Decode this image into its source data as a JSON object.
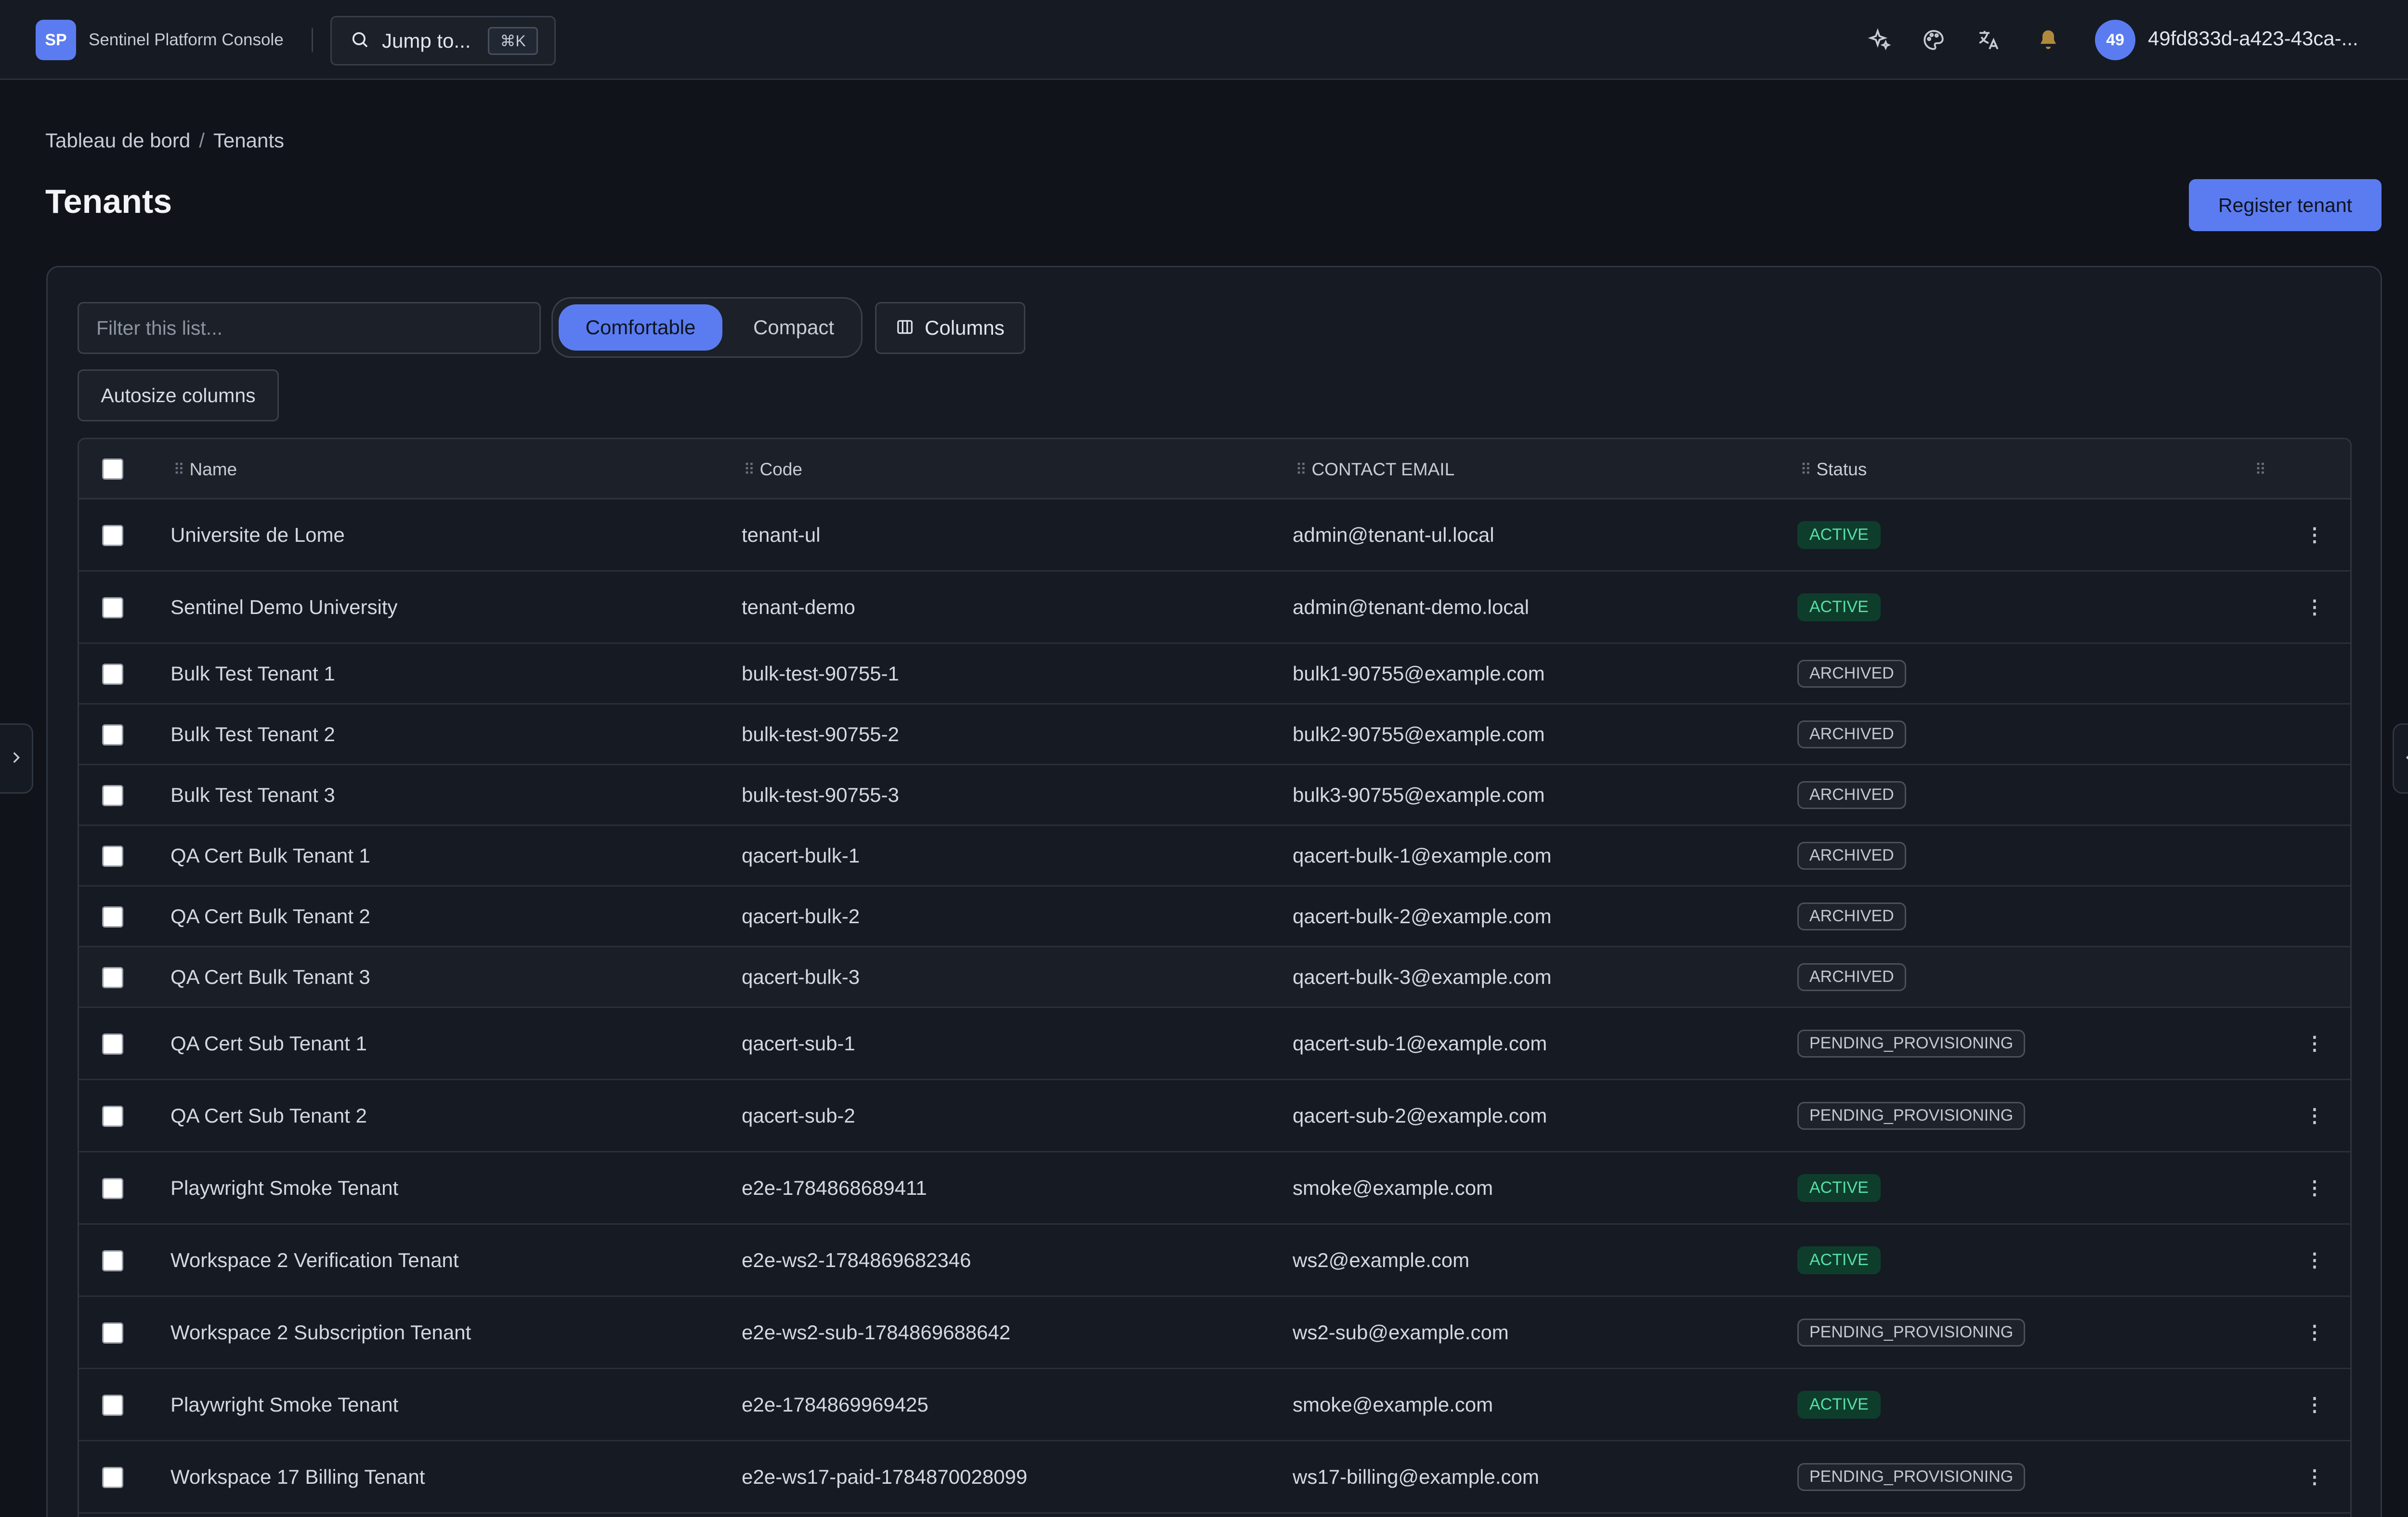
{
  "app": {
    "brand_initials": "SP",
    "brand_name": "Sentinel Platform Console",
    "jump_label": "Jump to...",
    "jump_shortcut": "⌘K",
    "user_initials": "49",
    "user_id": "49fd833d-a423-43ca-..."
  },
  "breadcrumb": {
    "home": "Tableau de bord",
    "separator": "/",
    "current": "Tenants"
  },
  "page": {
    "title": "Tenants",
    "register_label": "Register tenant"
  },
  "toolbar": {
    "filter_placeholder": "Filter this list...",
    "density_comfortable": "Comfortable",
    "density_compact": "Compact",
    "columns_label": "Columns",
    "autosize_label": "Autosize columns"
  },
  "table": {
    "headers": {
      "name": "Name",
      "code": "Code",
      "email": "CONTACT EMAIL",
      "status": "Status"
    },
    "rows": [
      {
        "name": "Universite de Lome",
        "code": "tenant-ul",
        "email": "admin@tenant-ul.local",
        "status": "ACTIVE"
      },
      {
        "name": "Sentinel Demo University",
        "code": "tenant-demo",
        "email": "admin@tenant-demo.local",
        "status": "ACTIVE"
      },
      {
        "name": "Bulk Test Tenant 1",
        "code": "bulk-test-90755-1",
        "email": "bulk1-90755@example.com",
        "status": "ARCHIVED"
      },
      {
        "name": "Bulk Test Tenant 2",
        "code": "bulk-test-90755-2",
        "email": "bulk2-90755@example.com",
        "status": "ARCHIVED"
      },
      {
        "name": "Bulk Test Tenant 3",
        "code": "bulk-test-90755-3",
        "email": "bulk3-90755@example.com",
        "status": "ARCHIVED"
      },
      {
        "name": "QA Cert Bulk Tenant 1",
        "code": "qacert-bulk-1",
        "email": "qacert-bulk-1@example.com",
        "status": "ARCHIVED"
      },
      {
        "name": "QA Cert Bulk Tenant 2",
        "code": "qacert-bulk-2",
        "email": "qacert-bulk-2@example.com",
        "status": "ARCHIVED"
      },
      {
        "name": "QA Cert Bulk Tenant 3",
        "code": "qacert-bulk-3",
        "email": "qacert-bulk-3@example.com",
        "status": "ARCHIVED"
      },
      {
        "name": "QA Cert Sub Tenant 1",
        "code": "qacert-sub-1",
        "email": "qacert-sub-1@example.com",
        "status": "PENDING_PROVISIONING"
      },
      {
        "name": "QA Cert Sub Tenant 2",
        "code": "qacert-sub-2",
        "email": "qacert-sub-2@example.com",
        "status": "PENDING_PROVISIONING"
      },
      {
        "name": "Playwright Smoke Tenant",
        "code": "e2e-1784868689411",
        "email": "smoke@example.com",
        "status": "ACTIVE"
      },
      {
        "name": "Workspace 2 Verification Tenant",
        "code": "e2e-ws2-1784869682346",
        "email": "ws2@example.com",
        "status": "ACTIVE"
      },
      {
        "name": "Workspace 2 Subscription Tenant",
        "code": "e2e-ws2-sub-1784869688642",
        "email": "ws2-sub@example.com",
        "status": "PENDING_PROVISIONING"
      },
      {
        "name": "Playwright Smoke Tenant",
        "code": "e2e-1784869969425",
        "email": "smoke@example.com",
        "status": "ACTIVE"
      },
      {
        "name": "Workspace 17 Billing Tenant",
        "code": "e2e-ws17-paid-1784870028099",
        "email": "ws17-billing@example.com",
        "status": "PENDING_PROVISIONING"
      }
    ]
  },
  "colors": {
    "accent": "#5b7cf0",
    "background": "#10131a",
    "active_badge": "#56e0a8",
    "notification_bell": "#b08a3c"
  },
  "icons": [
    "search-icon",
    "sparkles-icon",
    "palette-icon",
    "translate-icon",
    "bell-icon",
    "columns-icon",
    "drag-handle-icon",
    "more-vertical-icon",
    "chevron-right-icon",
    "chevron-left-icon"
  ]
}
